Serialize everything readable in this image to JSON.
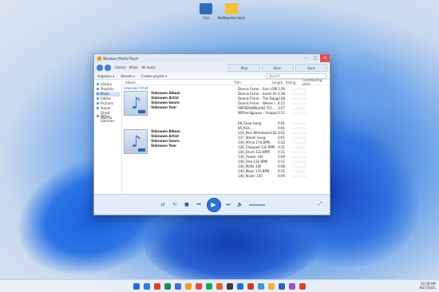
{
  "desktop": {
    "icons": [
      {
        "label": "Ciel",
        "color": "#2e6fb8"
      },
      {
        "label": "Neditpoints tools",
        "color": "#f3c23c"
      }
    ]
  },
  "window": {
    "title": "Windows Media Player",
    "controls": {
      "minimize": "–",
      "maximize": "□",
      "close": "✕"
    }
  },
  "nav": {
    "back": "‹",
    "forward": "›",
    "breadcrumb": [
      "Library",
      "Music",
      "All music"
    ],
    "tabs": [
      "Play",
      "Burn",
      "Sync"
    ]
  },
  "toolbar": {
    "organize": "Organize ▾",
    "stream": "Stream ▾",
    "create_playlist": "Create playlist ▾",
    "search_placeholder": "Search"
  },
  "sidebar": {
    "items": [
      "Library",
      "Playlists",
      "Music",
      "Videos",
      "Pictures",
      "Sniper Ghost Warrior"
    ],
    "selected": "Music",
    "other": "Other Libraries"
  },
  "columns": {
    "album": "Album",
    "title": "Title",
    "length": "Length",
    "rating": "Rating",
    "contributing": "Contributing artist"
  },
  "albums": [
    {
      "header": "Unknown Artist",
      "lines": [
        "Unknown Album",
        "Unknown Artist",
        "Unknown Genre",
        "Unknown Year"
      ]
    },
    {
      "header": "",
      "lines": [
        "Unknown Album",
        "Unknown Artist",
        "Unknown Genre",
        "Unknown Year"
      ]
    }
  ],
  "tracks_group1": [
    {
      "title": "Dennis Ferrer - Sinn (Offi...",
      "length": "3:59",
      "rating": "○○○○○"
    },
    {
      "title": "Dennis Ferrer - Sarah Pin...",
      "length": "3:36",
      "rating": "○○○○○"
    },
    {
      "title": "Dennis Ferrer - The Daug...",
      "length": "3:08",
      "rating": "○○○○○"
    },
    {
      "title": "Dennis Ferrer - Where I...",
      "length": "4:11",
      "rating": "○○○○○"
    },
    {
      "title": "[MP3DOWNLOAD.TO] ...",
      "length": "3:07",
      "rating": "○○○○○"
    },
    {
      "title": "MP3heiligpaars - Snappin...",
      "length": "3:11",
      "rating": "○○○○○"
    }
  ],
  "tracks_group2": [
    {
      "title": "68_Snap Gong",
      "length": "0:01",
      "rating": "○○○○○"
    },
    {
      "title": "85_Kick...",
      "length": "0:01",
      "rating": "○○○○○"
    },
    {
      "title": "116_Perc Whitebeard ID...",
      "length": "0:01",
      "rating": "○○○○○"
    },
    {
      "title": "127_Steam Gong",
      "length": "0:01",
      "rating": "○○○○○"
    },
    {
      "title": "140_Africa 170 BPM",
      "length": "0:22",
      "rating": "○○○○○"
    },
    {
      "title": "126_Chopped 132 BPM",
      "length": "0:11",
      "rating": "○○○○○"
    },
    {
      "title": "140_Drum 132 BPM",
      "length": "0:11",
      "rating": "○○○○○"
    },
    {
      "title": "140_Flower 140",
      "length": "0:09",
      "rating": "○○○○○"
    },
    {
      "title": "140_Free 132 BPM",
      "length": "0:11",
      "rating": "○○○○○"
    },
    {
      "title": "140_Mafia 140",
      "length": "0:08",
      "rating": "○○○○○"
    },
    {
      "title": "140_Moon 170 BPM",
      "length": "0:11",
      "rating": "○○○○○"
    },
    {
      "title": "140_Rosen 140",
      "length": "0:09",
      "rating": "○○○○○"
    }
  ],
  "player": {
    "shuffle": "⇄",
    "repeat": "↻",
    "stop": "■",
    "prev": "⏮",
    "play": "▶",
    "next": "⏭",
    "mute": "🔈",
    "switch": "⤢"
  },
  "taskbar": {
    "icon_colors": [
      "#1f6fe0",
      "#2f7be8",
      "#d9442c",
      "#1e8c5a",
      "#4470d0",
      "#f39b1e",
      "#eb4a3b",
      "#1ca35c",
      "#e0662c",
      "#3a3a3a",
      "#1f6fe0",
      "#d03b2f",
      "#3a9bd6",
      "#f2b233",
      "#2f64b4",
      "#a44ccf",
      "#d9442c"
    ],
    "time": "10:58 AM",
    "date": "8/27/2021"
  }
}
